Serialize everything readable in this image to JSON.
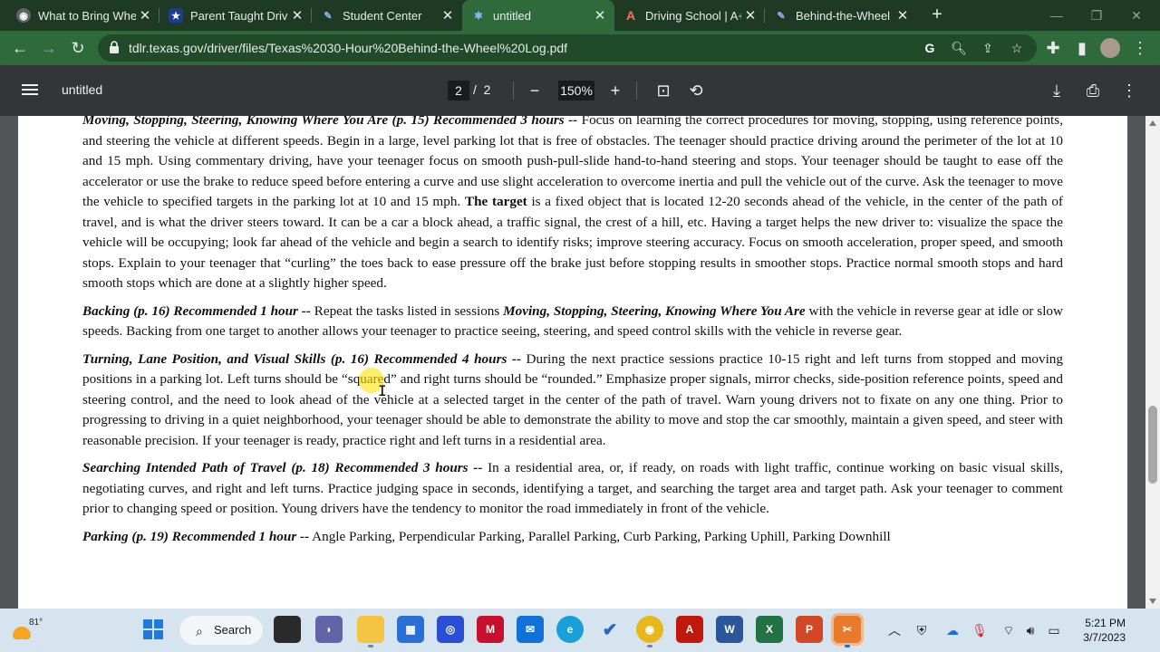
{
  "browser": {
    "tabs": [
      {
        "title": "What to Bring Whe",
        "favicon": "chrome-icon",
        "color": "#5f6368",
        "active": false
      },
      {
        "title": "Parent Taught Drive",
        "favicon": "texas-dps-icon",
        "color": "#1a3d8f",
        "active": false
      },
      {
        "title": "Student Center",
        "favicon": "feather-icon",
        "color": "#3b6fd8",
        "active": false
      },
      {
        "title": "untitled",
        "favicon": "texas-dps-icon",
        "color": "#1a3d8f",
        "active": true
      },
      {
        "title": "Driving School | A+",
        "favicon": "a-plus-icon",
        "color": "#d9342b",
        "active": false
      },
      {
        "title": "Behind-the-Wheel",
        "favicon": "feather-icon",
        "color": "#3b6fd8",
        "active": false
      }
    ],
    "url": "tdlr.texas.gov/driver/files/Texas%2030-Hour%20Behind-the-Wheel%20Log.pdf"
  },
  "pdf": {
    "title": "untitled",
    "page_current": "2",
    "page_separator": "/",
    "page_total": "2",
    "zoom": "150%"
  },
  "doc": {
    "p1": {
      "head": "Moving, Stopping, Steering, Knowing Where You Are (p. 15) Recommended 3 hours --",
      "body1": " Focus on learning the correct procedures for moving, stopping, using reference points, and steering the vehicle at different speeds. Begin in a large, level parking lot that is free of obstacles. The teenager should practice driving around the perimeter of the lot at 10 and 15 mph. Using commentary driving, have your teenager focus on smooth push-pull-slide hand-to-hand steering and stops. Your teenager should be taught to ease off the accelerator or use the brake to reduce speed before entering a curve and use slight acceleration to overcome inertia and pull the vehicle out of the curve. Ask the teenager to move the vehicle to specified targets in the parking lot at 10 and 15 mph. ",
      "bold": "The target",
      "body2": " is a fixed object that is located 12-20 seconds ahead of the vehicle, in the center of the path of travel, and is what the driver steers toward. It can be a car a block ahead, a traffic signal, the crest of a hill, etc. Having a target helps the new driver to: visualize the space the vehicle will be occupying; look far ahead of the vehicle and begin a search to identify risks; improve steering accuracy. Focus on smooth acceleration, proper speed, and smooth stops. Explain to your teenager that “curling” the toes back to ease pressure off the brake just before stopping results in smoother stops. Practice normal smooth stops and hard smooth stops which are done at a slightly higher speed."
    },
    "p2": {
      "head": "Backing (p. 16) Recommended 1 hour --",
      "body1": " Repeat the tasks listed in sessions ",
      "ref": "Moving, Stopping, Steering, Knowing Where You Are",
      "body2": " with the vehicle in reverse gear at idle or slow speeds. Backing from one target to another allows your teenager to practice seeing, steering, and speed control skills with the vehicle in reverse gear."
    },
    "p3": {
      "head": "Turning, Lane Position, and Visual Skills (p. 16) Recommended 4 hours --",
      "body": " During the next practice sessions practice 10-15 right and left turns from stopped and moving positions in a parking lot. Left turns should be “squared” and right turns should be “rounded.” Emphasize proper signals, mirror checks, side-position reference points, speed and steering control, and the need to look ahead of the vehicle at a selected target in the center of the path of travel. Warn young drivers not to fixate on any one thing.  Prior to progressing to driving in a quiet neighborhood, your teenager should be able to demonstrate the ability to move and stop the car smoothly, maintain a given speed, and steer with reasonable precision. If your teenager is ready, practice right and left turns in a residential area."
    },
    "p4": {
      "head": "Searching Intended Path of Travel (p. 18) Recommended 3 hours --",
      "body": " In a residential area, or, if ready, on roads with light traffic, continue working on basic visual skills, negotiating curves, and right and left turns. Practice judging space in seconds, identifying a target, and searching the target area and target path. Ask your teenager to comment prior to changing speed or position. Young drivers have the tendency to monitor the road immediately in front of the vehicle."
    },
    "p5": {
      "head": "Parking (p. 19) Recommended 1 hour --",
      "body": " Angle Parking, Perpendicular Parking, Parallel Parking, Curb Parking, Parking Uphill, Parking Downhill"
    }
  },
  "taskbar": {
    "temperature": "81°",
    "search_label": "Search",
    "time": "5:21 PM",
    "date": "3/7/2023",
    "apps": [
      "windows-start-icon",
      "search",
      "task-view-icon",
      "teams-chat-icon",
      "file-explorer-icon",
      "microsoft-store-icon",
      "webex-icon",
      "mcafee-icon",
      "outlook-mail-icon",
      "edge-icon",
      "todo-icon",
      "chrome-icon",
      "acrobat-icon",
      "word-icon",
      "excel-icon",
      "powerpoint-icon",
      "snipping-tool-icon"
    ]
  }
}
